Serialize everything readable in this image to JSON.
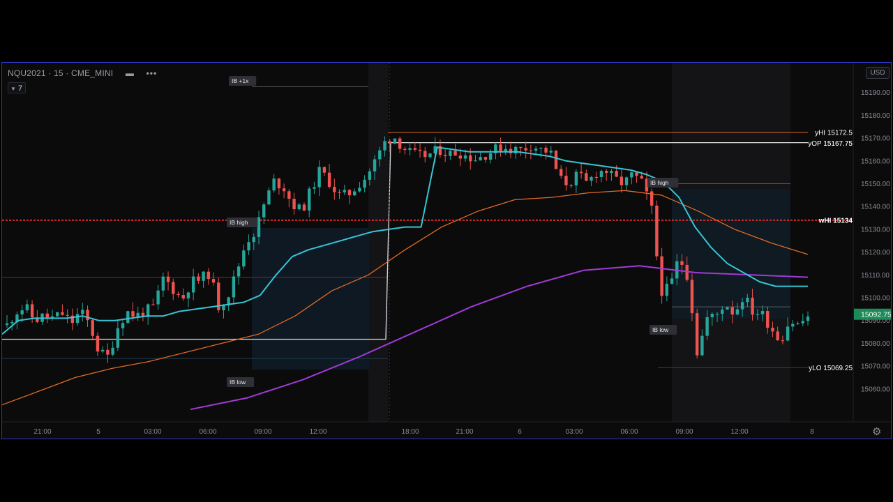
{
  "app": {
    "symbol_title": "NQU2021 · 15 · CME_MINI",
    "minimize_glyph": "▬",
    "more_glyph": "•••",
    "indicator_count_label": "7",
    "currency_button": "USD",
    "settings_icon": "gear-icon"
  },
  "colors": {
    "background": "#0b0b0c",
    "up_candle": "#26a69a",
    "down_candle": "#ef5350",
    "vwap_cyan": "#36c5d6",
    "ema_orange": "#e06a26",
    "sma_purple": "#a23ad8",
    "level_red": "#d62d2d",
    "frame_border": "#2e3bd6",
    "last_price_bg": "#1d8a5a"
  },
  "chart_data": {
    "type": "candlestick",
    "title": "",
    "price_scale": {
      "ticks": [
        "15190.00",
        "15180.00",
        "15170.00",
        "15160.00",
        "15150.00",
        "15140.00",
        "15130.00",
        "15120.00",
        "15110.00",
        "15100.00",
        "15090.00",
        "15080.00",
        "15070.00",
        "15060.00"
      ],
      "ylim": [
        15051,
        15204
      ],
      "last_price_label": "15092.75"
    },
    "time_axis": {
      "labels": [
        "21:00",
        "5",
        "03:00",
        "06:00",
        "09:00",
        "12:00",
        "18:00",
        "21:00",
        "6",
        "03:00",
        "06:00",
        "09:00",
        "12:00",
        "8"
      ]
    },
    "level_labels": [
      {
        "text": "yHI 15172.5",
        "price": 15172.5
      },
      {
        "text": "wHI 15134",
        "price": 15134
      },
      {
        "text": "yLO 15069.25",
        "price": 15069.25
      }
    ],
    "overlapped_label": {
      "text": "yOP 15167.75",
      "overlay_text": "15167.75",
      "price": 15167.75
    },
    "ib_tags": [
      "IB +1x",
      "IB high",
      "IB low",
      "IB high",
      "IB low"
    ],
    "series": [
      {
        "name": "price_path",
        "values": [
          15088,
          15094,
          15096,
          15090,
          15092,
          15091,
          15093,
          15089,
          15094,
          15088,
          15076,
          15074,
          15087,
          15094,
          15092,
          15094,
          15096,
          15109,
          15104,
          15099,
          15107,
          15108,
          15111,
          15096,
          15101,
          15112,
          15125,
          15129,
          15142,
          15151,
          15149,
          15141,
          15138,
          15147,
          15156,
          15151,
          15145,
          15145,
          15149,
          15153,
          15160,
          15168,
          15171,
          15166,
          15163,
          15162,
          15163,
          15165,
          15163,
          15164,
          15162,
          15161,
          15163,
          15165,
          15166,
          15165,
          15165,
          15167,
          15165,
          15164,
          15152,
          15150,
          15154,
          15150,
          15155,
          15156,
          15152,
          15150,
          15154,
          15150,
          15140,
          15103,
          15104,
          15118,
          15109,
          15075,
          15091,
          15092,
          15098,
          15093,
          15101,
          15094,
          15093,
          15087,
          15081,
          15090,
          15088,
          15092
        ]
      },
      {
        "name": "vwap",
        "values": [
          15084,
          15090,
          15091,
          15091,
          15091,
          15092,
          15090,
          15090,
          15091,
          15092,
          15092,
          15094,
          15095,
          15096,
          15097,
          15098,
          15101,
          15110,
          15118,
          15121,
          15123,
          15125,
          15127,
          15129,
          15130,
          15131,
          15131,
          15166,
          15165,
          15164,
          15164,
          15164,
          15164,
          15163,
          15162,
          15160,
          15159,
          15158,
          15157,
          15156,
          15154,
          15151,
          15144,
          15131,
          15122,
          15115,
          15111,
          15107,
          15105,
          15105,
          15105
        ]
      },
      {
        "name": "ema",
        "values": [
          15053,
          15059,
          15065,
          15069,
          15072,
          15076,
          15080,
          15084,
          15092,
          15103,
          15110,
          15121,
          15131,
          15138,
          15143,
          15144,
          15146,
          15147,
          15145,
          15138,
          15130,
          15124,
          15119
        ]
      },
      {
        "name": "sma",
        "values": [
          15051,
          15056,
          15064,
          15074,
          15085,
          15096,
          15105,
          15112,
          15114,
          15111,
          15110,
          15109
        ]
      }
    ]
  }
}
